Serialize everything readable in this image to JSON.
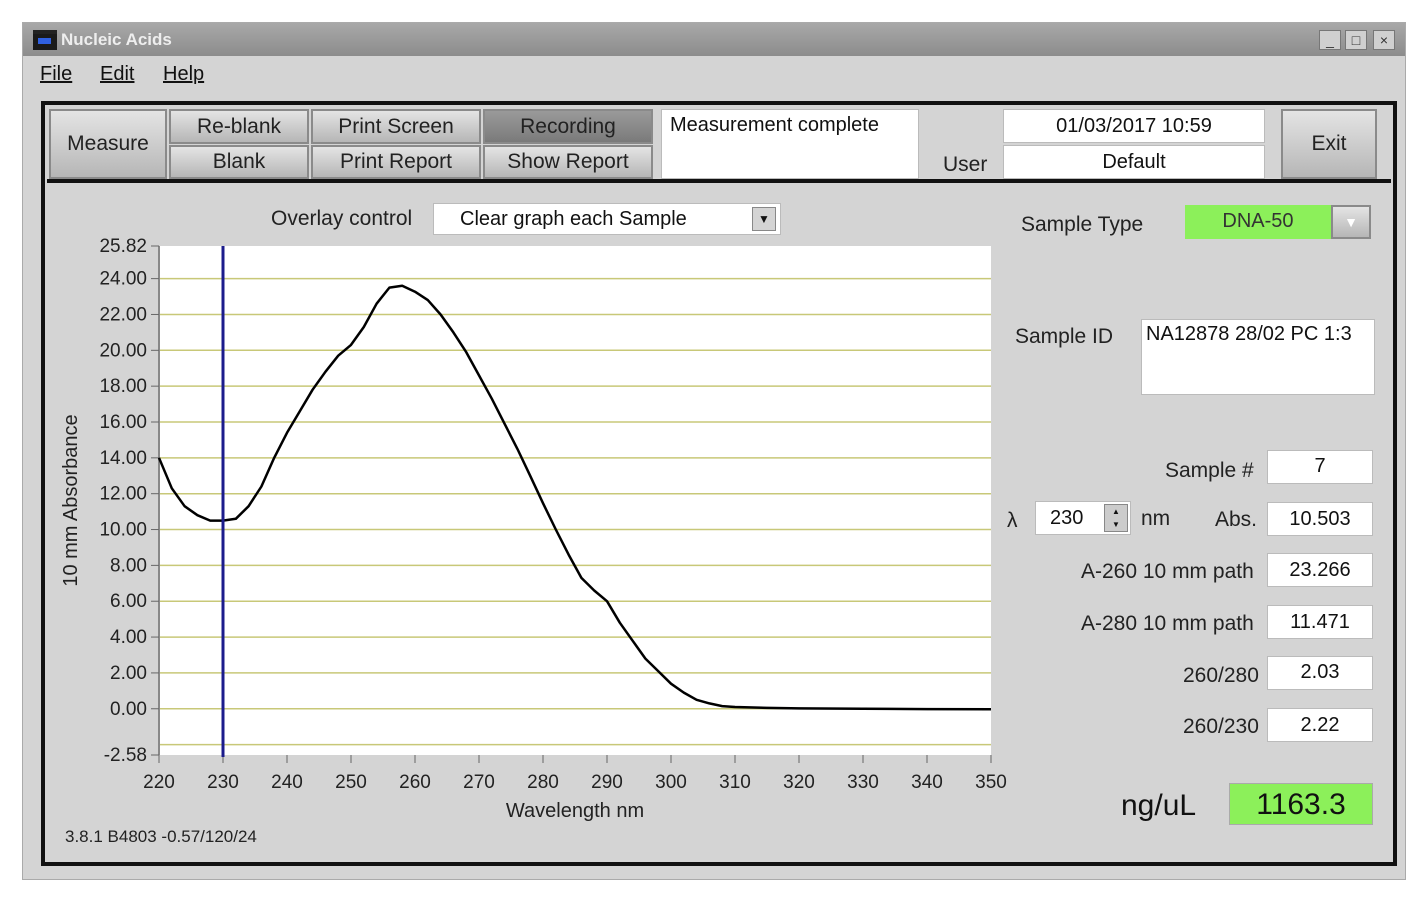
{
  "window": {
    "title": "Nucleic Acids",
    "controls": [
      "_",
      "□",
      "×"
    ]
  },
  "menu": [
    "File",
    "Edit",
    "Help"
  ],
  "toolbar": {
    "measure": "Measure",
    "reblank": "Re-blank",
    "blank": "Blank",
    "print_screen": "Print Screen",
    "print_report": "Print Report",
    "recording": "Recording",
    "show_report": "Show Report",
    "status": "Measurement complete",
    "datetime": "01/03/2017  10:59",
    "user_label": "User",
    "user": "Default",
    "exit": "Exit"
  },
  "overlay": {
    "label": "Overlay control",
    "value": "Clear graph each Sample"
  },
  "sample": {
    "type_label": "Sample Type",
    "type": "DNA-50",
    "id_label": "Sample ID",
    "id": "NA12878 28/02 PC 1:3",
    "number_label": "Sample #",
    "number": "7",
    "lambda_symbol": "λ",
    "lambda": "230",
    "lambda_unit": "nm",
    "abs_label": "Abs.",
    "abs": "10.503",
    "a260_label": "A-260 10 mm path",
    "a260": "23.266",
    "a280_label": "A-280 10 mm path",
    "a280": "11.471",
    "r260_280_label": "260/280",
    "r260_280": "2.03",
    "r260_230_label": "260/230",
    "r260_230": "2.22",
    "conc_label": "ng/uL",
    "conc": "1163.3"
  },
  "version": "3.8.1 B4803 -0.57/120/24",
  "colors": {
    "green": "#8cf05a",
    "cursor": "#1c1c8c",
    "grid": "#c8c878"
  },
  "chart_data": {
    "type": "line",
    "xlabel": "Wavelength nm",
    "ylabel": "10 mm Absorbance",
    "xlim": [
      220,
      350
    ],
    "ylim": [
      -2.58,
      25.82
    ],
    "xticks": [
      "220",
      "230",
      "240",
      "250",
      "260",
      "270",
      "280",
      "290",
      "300",
      "310",
      "320",
      "330",
      "340",
      "350"
    ],
    "yticks": [
      "25.82",
      "24.00",
      "22.00",
      "20.00",
      "18.00",
      "16.00",
      "14.00",
      "12.00",
      "10.00",
      "8.00",
      "6.00",
      "4.00",
      "2.00",
      "0.00",
      "-2.58"
    ],
    "grid": true,
    "cursor_x": 230,
    "x": [
      220,
      222,
      224,
      226,
      228,
      230,
      232,
      234,
      236,
      238,
      240,
      242,
      244,
      246,
      248,
      250,
      252,
      254,
      256,
      258,
      260,
      262,
      264,
      266,
      268,
      270,
      272,
      274,
      276,
      278,
      280,
      282,
      284,
      286,
      288,
      290,
      292,
      294,
      296,
      298,
      300,
      302,
      304,
      306,
      308,
      310,
      315,
      320,
      330,
      340,
      350
    ],
    "y": [
      14.0,
      12.3,
      11.3,
      10.8,
      10.5,
      10.5,
      10.6,
      11.3,
      12.4,
      14.0,
      15.4,
      16.6,
      17.8,
      18.8,
      19.7,
      20.3,
      21.3,
      22.6,
      23.5,
      23.6,
      23.27,
      22.8,
      22.0,
      21.0,
      19.9,
      18.6,
      17.3,
      15.9,
      14.5,
      13.0,
      11.47,
      10.0,
      8.6,
      7.3,
      6.6,
      6.0,
      4.8,
      3.8,
      2.8,
      2.1,
      1.4,
      0.9,
      0.5,
      0.3,
      0.15,
      0.1,
      0.05,
      0.02,
      0.0,
      -0.02,
      -0.03
    ]
  }
}
